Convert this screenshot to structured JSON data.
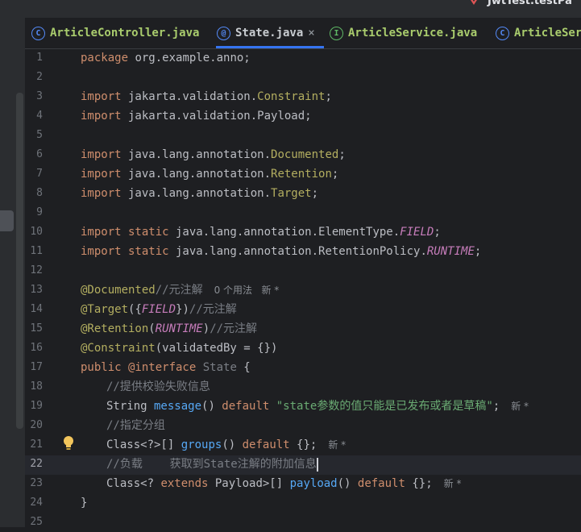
{
  "top": {
    "run_config": "JwtTest.testPa"
  },
  "tabs": [
    {
      "label": "ArticleController.java",
      "icon": "class-icon",
      "style": "green"
    },
    {
      "label": "State.java",
      "icon": "annotation-icon",
      "style": "active",
      "close": "×"
    },
    {
      "label": "ArticleService.java",
      "icon": "interface-icon",
      "style": "green"
    },
    {
      "label": "ArticleSer",
      "icon": "class-icon",
      "style": "green"
    }
  ],
  "gutter": {
    "line_numbers": [
      "1",
      "2",
      "3",
      "4",
      "5",
      "6",
      "7",
      "8",
      "9",
      "10",
      "11",
      "12",
      "13",
      "14",
      "15",
      "16",
      "17",
      "18",
      "19",
      "20",
      "21",
      "22",
      "23",
      "24",
      "25"
    ],
    "current_line": "22"
  },
  "code": {
    "l1": {
      "kw": "package",
      "rest": " org.example.anno;"
    },
    "l3": {
      "kw": "import",
      "pkg": " jakarta.validation.",
      "cls": "Constraint",
      "end": ";"
    },
    "l4": {
      "kw": "import",
      "rest": " jakarta.validation.Payload;"
    },
    "l6": {
      "kw": "import",
      "pkg": " java.lang.annotation.",
      "cls": "Documented",
      "end": ";"
    },
    "l7": {
      "kw": "import",
      "pkg": " java.lang.annotation.",
      "cls": "Retention",
      "end": ";"
    },
    "l8": {
      "kw": "import",
      "pkg": " java.lang.annotation.",
      "cls": "Target",
      "end": ";"
    },
    "l10": {
      "kw": "import static",
      "pkg": " java.lang.annotation.ElementType.",
      "cst": "FIELD",
      "end": ";"
    },
    "l11": {
      "kw": "import static",
      "pkg": " java.lang.annotation.RetentionPolicy.",
      "cst": "RUNTIME",
      "end": ";"
    },
    "l13": {
      "ann": "@Documented",
      "cmt": "//元注解",
      "hint": "0 个用法   新 *"
    },
    "l14": {
      "ann": "@Target",
      "p1": "({",
      "cst": "FIELD",
      "p2": "})",
      "cmt": "//元注解"
    },
    "l15": {
      "ann": "@Retention",
      "p1": "(",
      "cst": "RUNTIME",
      "p2": ")",
      "cmt": "//元注解"
    },
    "l16": {
      "ann": "@Constraint",
      "rest": "(validatedBy = {})"
    },
    "l17": {
      "kw": "public",
      "ann": " @interface",
      "name": " State",
      "rest": " {"
    },
    "l18": {
      "cmt": "//提供校验失败信息"
    },
    "l19": {
      "type": "String",
      "fn": " message",
      "paren": "()",
      "kw": " default",
      "str": " \"state参数的值只能是已发布或者是草稿\"",
      "end": ";",
      "hint": "新 *"
    },
    "l20": {
      "cmt": "//指定分组"
    },
    "l21": {
      "type": "Class<?>[]",
      "fn": " groups",
      "paren": "()",
      "kw": " default",
      "rest": " {};",
      "hint": "新 *"
    },
    "l22": {
      "cmt": "//负载    获取到State注解的附加信息"
    },
    "l23": {
      "type1": "Class<?",
      "kw1": " extends",
      "type2": " Payload>[]",
      "fn": " payload",
      "paren": "()",
      "kw": " default",
      "rest": " {};",
      "hint": "新 *"
    },
    "l24": {
      "rest": "}"
    }
  },
  "colors": {
    "background": "#1e1f22",
    "keyword": "#cf8e6d",
    "annotation": "#b3ae60",
    "constant": "#c77dbb",
    "comment": "#7a7e85",
    "string": "#6aab73",
    "method": "#56a8f5",
    "accent": "#3574f0"
  }
}
